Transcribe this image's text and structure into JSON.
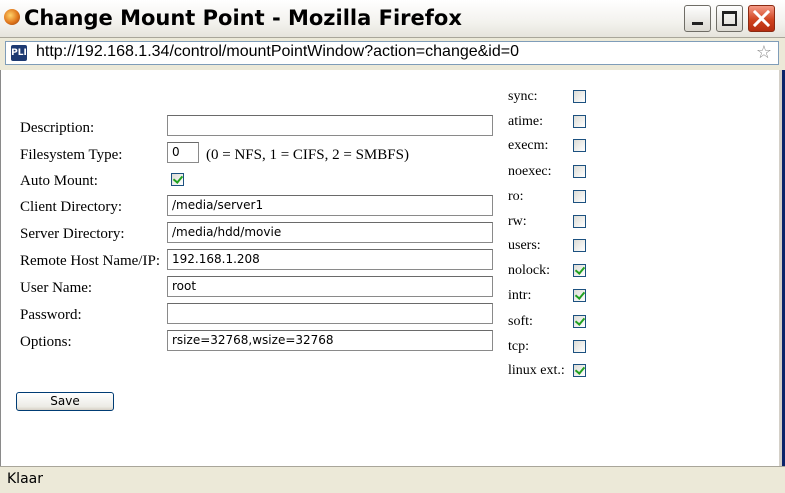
{
  "window": {
    "title": "Change Mount Point - Mozilla Firefox"
  },
  "addressbar": {
    "site_badge": "PLI",
    "url": "http://192.168.1.34/control/mountPointWindow?action=change&id=0"
  },
  "form": {
    "description": {
      "label": "Description:",
      "value": ""
    },
    "filesystem_type": {
      "label": "Filesystem Type:",
      "value": "0",
      "hint": "(0 = NFS, 1 = CIFS, 2 = SMBFS)"
    },
    "auto_mount": {
      "label": "Auto Mount:",
      "checked": true
    },
    "client_directory": {
      "label": "Client Directory:",
      "value": "/media/server1"
    },
    "server_directory": {
      "label": "Server Directory:",
      "value": "/media/hdd/movie"
    },
    "remote_host": {
      "label": "Remote Host Name/IP:",
      "value": "192.168.1.208"
    },
    "user_name": {
      "label": "User Name:",
      "value": "root"
    },
    "password": {
      "label": "Password:",
      "value": ""
    },
    "options": {
      "label": "Options:",
      "value": "rsize=32768,wsize=32768"
    },
    "save_label": "Save"
  },
  "mount_options": [
    {
      "label": "sync:",
      "checked": false
    },
    {
      "label": "atime:",
      "checked": false
    },
    {
      "label": "execm:",
      "checked": false
    },
    {
      "label": "noexec:",
      "checked": false
    },
    {
      "label": "ro:",
      "checked": false
    },
    {
      "label": "rw:",
      "checked": false
    },
    {
      "label": "users:",
      "checked": false
    },
    {
      "label": "nolock:",
      "checked": true
    },
    {
      "label": "intr:",
      "checked": true
    },
    {
      "label": "soft:",
      "checked": true
    },
    {
      "label": "tcp:",
      "checked": false
    },
    {
      "label": "linux ext.:",
      "checked": true
    }
  ],
  "statusbar": {
    "text": "Klaar"
  },
  "colors": {
    "check_green": "#21a121",
    "close_red": "#d0441f"
  }
}
